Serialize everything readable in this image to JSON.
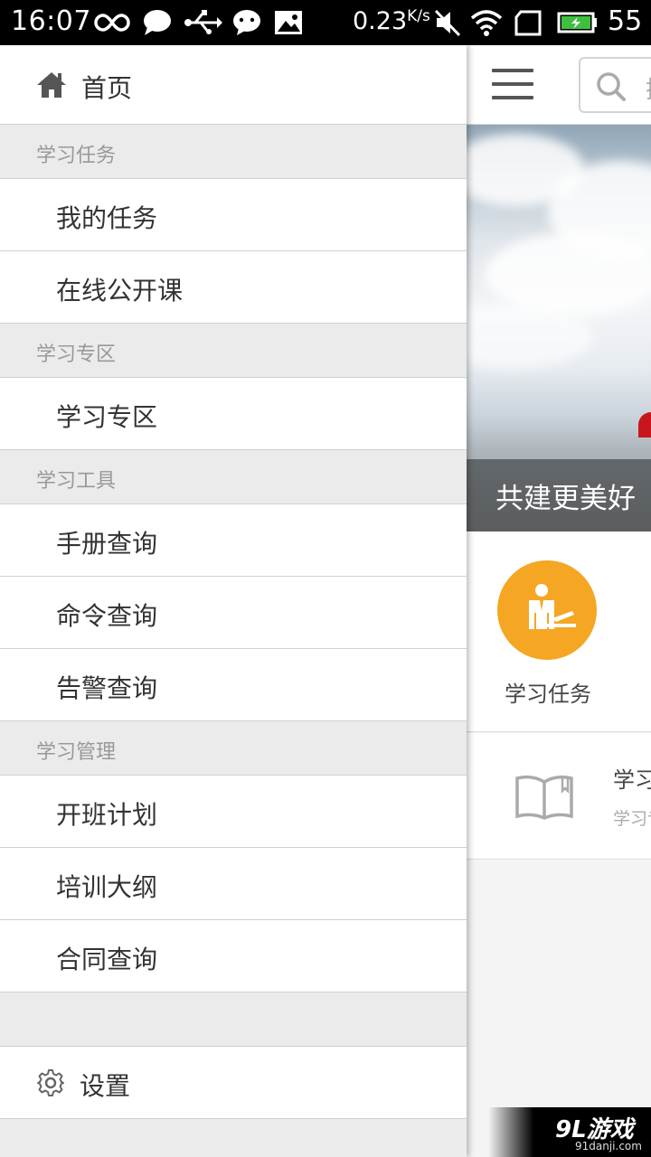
{
  "status_bar": {
    "time": "16:07",
    "speed_value": "0.23",
    "speed_unit": "K/s",
    "battery_level": "55",
    "icons": [
      "infinity-icon",
      "message-bubble-icon",
      "usb-icon",
      "wechat-icon",
      "image-icon",
      "mute-icon",
      "wifi-icon",
      "sim-icon",
      "battery-icon"
    ]
  },
  "drawer": {
    "home_label": "首页",
    "sections": [
      {
        "header": "学习任务",
        "items": [
          "我的任务",
          "在线公开课"
        ]
      },
      {
        "header": "学习专区",
        "items": [
          "学习专区"
        ]
      },
      {
        "header": "学习工具",
        "items": [
          "手册查询",
          "命令查询",
          "告警查询"
        ]
      },
      {
        "header": "学习管理",
        "items": [
          "开班计划",
          "培训大纲",
          "合同查询"
        ]
      }
    ],
    "settings_label": "设置"
  },
  "main": {
    "search_placeholder": "搜",
    "banner_caption": "共建更美好",
    "quick_task_label": "学习任务",
    "study_row": {
      "title": "学习",
      "subtitle": "学习专区"
    }
  },
  "watermark": {
    "brand": "9L游戏",
    "url": "91danji.com"
  },
  "colors": {
    "accent_orange": "#f5a623",
    "drawer_header_bg": "#ebebeb",
    "flag_red": "#c8161d"
  }
}
